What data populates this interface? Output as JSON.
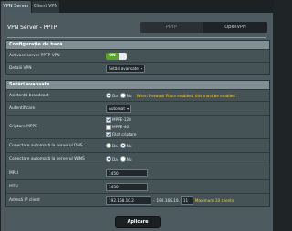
{
  "tabs": [
    "VPN Server",
    "Client VPN"
  ],
  "page": {
    "title": "VPN Server - PPTP",
    "switcher": [
      "PPTP",
      "OpenVPN"
    ]
  },
  "basic": {
    "header": "Configurație de bază",
    "rows": {
      "enable": {
        "label": "Activare server PPTP VPN",
        "toggle_text": "ON"
      },
      "details": {
        "label": "Detalii VPN",
        "value": "Setări avansate"
      }
    }
  },
  "advanced": {
    "header": "Setări avansate",
    "broadcast": {
      "label": "Asistență broadcast",
      "options": [
        "Da",
        "Nu"
      ],
      "selected": "Da",
      "warning": "When Network Place enabled, this must be enabled"
    },
    "auth": {
      "label": "Autentificare",
      "value": "Automat"
    },
    "mppe": {
      "label": "Criptare MPPE",
      "options": [
        "MPPE-128",
        "MPPE-40",
        "Fără criptare"
      ],
      "checked": [
        true,
        false,
        true
      ]
    },
    "dns": {
      "label": "Conectare automată la serverul DNS",
      "options": [
        "Da",
        "Nu"
      ],
      "selected": "Nu"
    },
    "wins": {
      "label": "Conectare automată la serverul WINS",
      "options": [
        "Da",
        "Nu"
      ],
      "selected": "Da"
    },
    "mru": {
      "label": "MRU",
      "value": "1450"
    },
    "mtu": {
      "label": "MTU",
      "value": "1450"
    },
    "client_ip": {
      "label": "Adresă IP client",
      "start": "192.168.10.2",
      "dash": "-",
      "end_prefix": "192.168.10.",
      "end_value": "11",
      "hint": "Maximum 10 clients"
    }
  },
  "apply_label": "Aplicare",
  "colors": {
    "accent_line": "#5fa6d6",
    "toggle_on": "#5aa42d",
    "warning_text": "#ffcc33"
  }
}
